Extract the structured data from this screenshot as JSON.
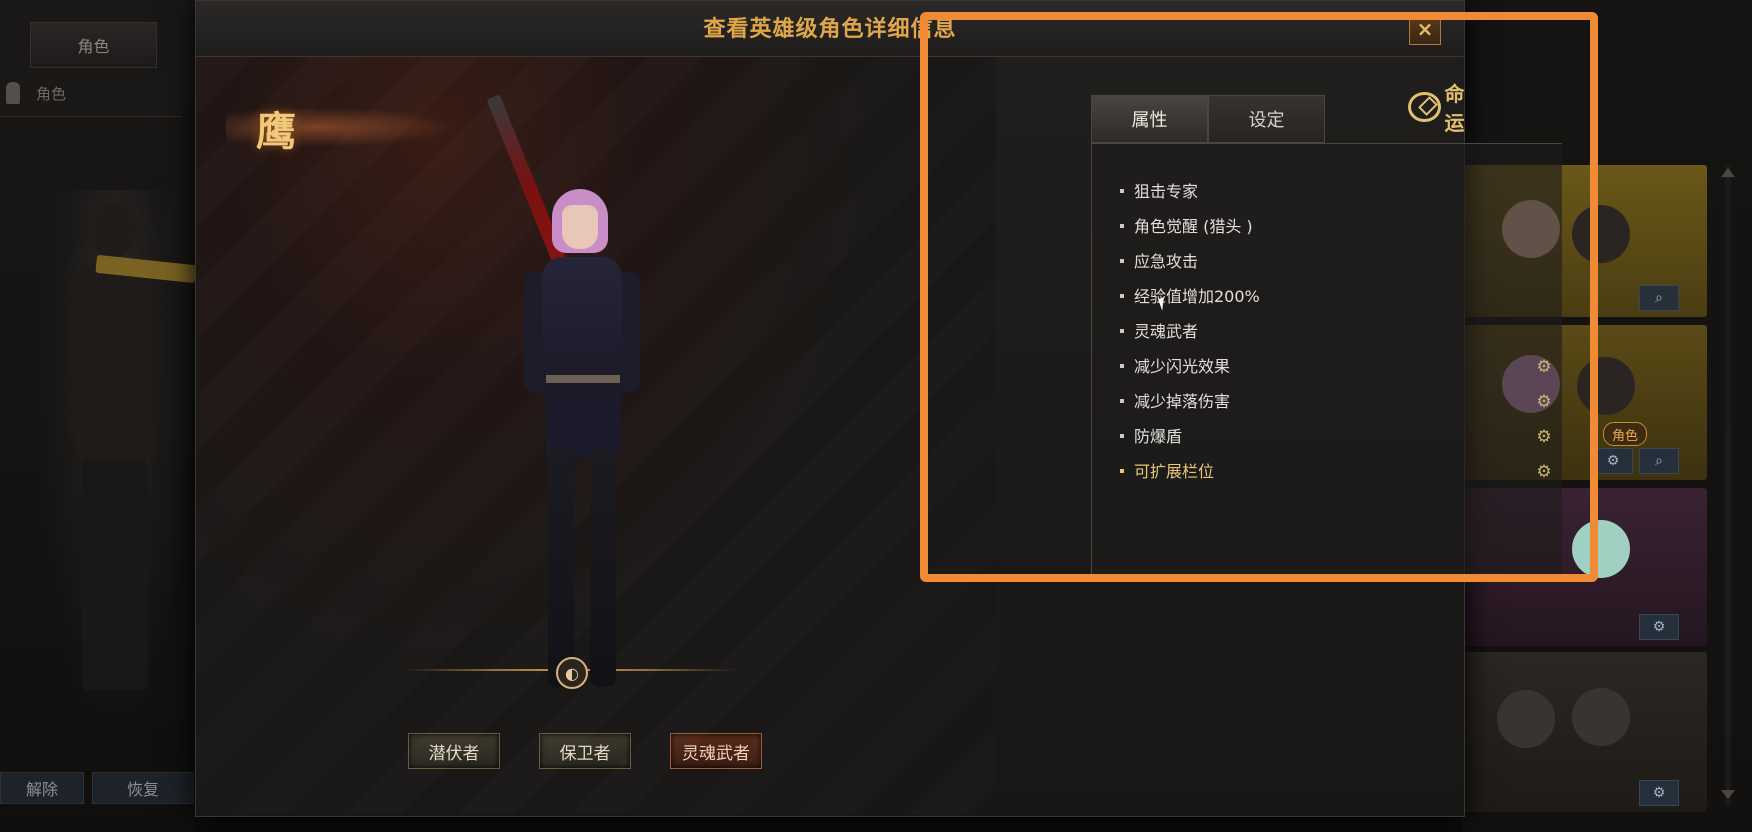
{
  "background": {
    "left_tab": "角色",
    "role_label": "角色",
    "bottom_left_button": "解除",
    "bottom_right_button": "恢复",
    "card_tag": "角色"
  },
  "modal": {
    "title": "查看英雄级角色详细信息",
    "close_label": "×",
    "class_emblem": "鹰",
    "rotate_icon": "◐",
    "skill_buttons": [
      "潜伏者",
      "保卫者",
      "灵魂武者"
    ],
    "tabs": [
      {
        "label": "属性",
        "active": true
      },
      {
        "label": "设定",
        "active": false
      }
    ],
    "logo_text": "命运",
    "attributes": [
      {
        "label": "狙击专家",
        "gear": false,
        "color": "#e2ded8"
      },
      {
        "label": "角色觉醒 (猎头 )",
        "gear": false,
        "color": "#e2ded8"
      },
      {
        "label": "应急攻击",
        "gear": false,
        "color": "#e2ded8"
      },
      {
        "label": "经验值增加200%",
        "gear": false,
        "color": "#e2ded8"
      },
      {
        "label": "灵魂武者",
        "gear": false,
        "color": "#e2ded8"
      },
      {
        "label": "减少闪光效果",
        "gear": true,
        "color": "#e2ded8"
      },
      {
        "label": "减少掉落伤害",
        "gear": true,
        "color": "#e2ded8"
      },
      {
        "label": "防爆盾",
        "gear": true,
        "color": "#e2ded8"
      },
      {
        "label": "可扩展栏位",
        "gear": true,
        "color": "#e7c774"
      }
    ]
  },
  "icons": {
    "gear": "gear-icon",
    "search": "search-icon",
    "close": "close-icon",
    "rotate": "rotate-icon"
  },
  "colors": {
    "accent_gold": "#e0a64a",
    "highlight_orange": "#f08a34"
  }
}
